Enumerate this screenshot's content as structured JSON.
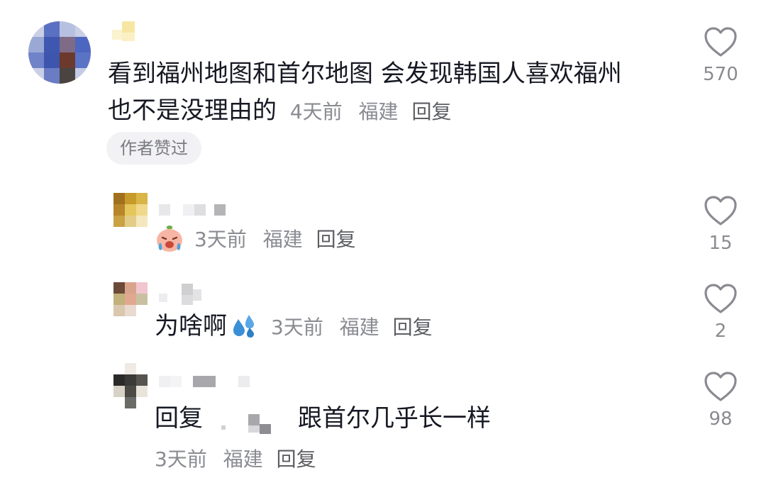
{
  "comments": [
    {
      "text_line1": "看到福州地图和首尔地图 会发现韩国人喜欢福州",
      "text_line2": "也不是没理由的",
      "time": "4天前",
      "location": "福建",
      "reply": "回复",
      "badge": "作者赞过",
      "likes": "570"
    }
  ],
  "replies": [
    {
      "time": "3天前",
      "location": "福建",
      "reply": "回复",
      "likes": "15",
      "emoji": "crying-face-emoji"
    },
    {
      "text": "为啥啊",
      "time": "3天前",
      "location": "福建",
      "reply": "回复",
      "likes": "2",
      "emoji": "sweat-droplets-emoji"
    },
    {
      "reply_prefix": "回复",
      "text": "跟首尔几乎长一样",
      "time": "3天前",
      "location": "福建",
      "reply": "回复",
      "likes": "98"
    }
  ],
  "colors": {
    "text": "#161823",
    "meta": "#8a8b91",
    "badge_bg": "#f2f2f4"
  }
}
